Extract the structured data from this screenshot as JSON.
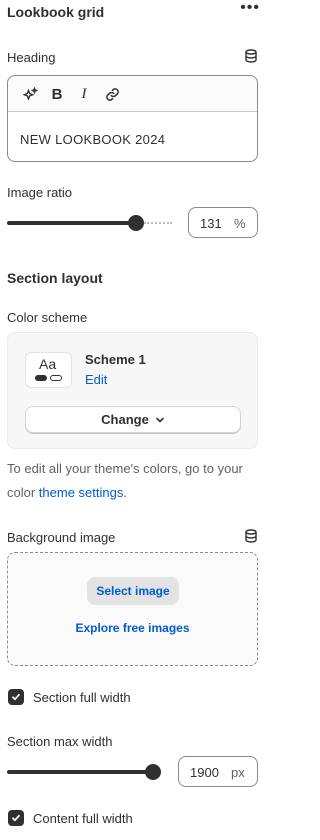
{
  "panel": {
    "title": "Lookbook grid",
    "more_label": "•••"
  },
  "heading": {
    "label": "Heading",
    "value": "NEW LOOKBOOK 2024",
    "toolbar": {
      "bold": "B",
      "italic": "I"
    }
  },
  "image_ratio": {
    "label": "Image ratio",
    "value": "131",
    "unit": "%",
    "slider_fraction": 0.78
  },
  "section_layout": {
    "heading": "Section layout"
  },
  "color_scheme": {
    "label": "Color scheme",
    "swatch_text": "Aa",
    "name": "Scheme 1",
    "edit_label": "Edit",
    "change_label": "Change"
  },
  "help": {
    "prefix": "To edit all your theme's colors, go to your color ",
    "link": "theme settings",
    "suffix": "."
  },
  "background_image": {
    "label": "Background image",
    "select_label": "Select image",
    "explore_label": "Explore free images"
  },
  "section_full_width": {
    "label": "Section full width",
    "checked": true
  },
  "section_max_width": {
    "label": "Section max width",
    "value": "1900",
    "unit": "px",
    "slider_fraction": 1.0
  },
  "content_full_width": {
    "label": "Content full width",
    "checked": true
  },
  "colors": {
    "text": "#303030",
    "link": "#005bd3",
    "muted": "#616161",
    "card_bg": "#f7f7f7"
  }
}
